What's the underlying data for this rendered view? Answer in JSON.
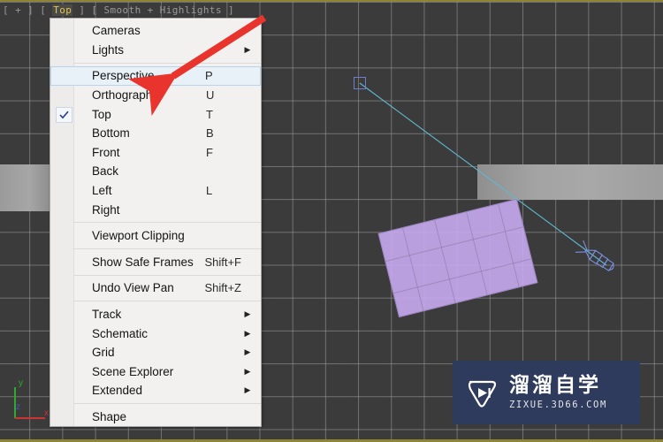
{
  "viewport": {
    "label_parts": {
      "open": "[",
      "plus": "+",
      "b1": "]",
      "b2": "[",
      "view": "Top",
      "b3": "]",
      "b4": "[",
      "shading": "Smooth + Highlights",
      "close": "]"
    },
    "label_full": "[ + ] [ Top ] [ Smooth + Highlights ]",
    "active_border_color": "#8d8437",
    "background_color": "#3b3b3b",
    "grid_line_color": "#a0a0a0",
    "objects": {
      "camera_target": "camera-target-square",
      "camera_gizmo": "camera-wireframe",
      "camera_line": "camera-target-line",
      "box_color": "#c6a8ee",
      "wall_color": "#a3a3a3"
    },
    "axis_tripod": {
      "x_label": "x",
      "y_label": "y",
      "z_label": "z",
      "x_color": "#cc3333",
      "y_color": "#33aa33",
      "z_color": "#4455cc"
    }
  },
  "context_menu": {
    "items": [
      {
        "label": "Cameras",
        "shortcut": "",
        "arrow": true,
        "checked": false,
        "selected": false,
        "separator_after": false
      },
      {
        "label": "Lights",
        "shortcut": "",
        "arrow": true,
        "checked": false,
        "selected": false,
        "separator_after": true
      },
      {
        "label": "Perspective",
        "shortcut": "P",
        "arrow": false,
        "checked": false,
        "selected": true,
        "separator_after": false
      },
      {
        "label": "Orthographic",
        "shortcut": "U",
        "arrow": false,
        "checked": false,
        "selected": false,
        "separator_after": false
      },
      {
        "label": "Top",
        "shortcut": "T",
        "arrow": false,
        "checked": true,
        "selected": false,
        "separator_after": false
      },
      {
        "label": "Bottom",
        "shortcut": "B",
        "arrow": false,
        "checked": false,
        "selected": false,
        "separator_after": false
      },
      {
        "label": "Front",
        "shortcut": "F",
        "arrow": false,
        "checked": false,
        "selected": false,
        "separator_after": false
      },
      {
        "label": "Back",
        "shortcut": "",
        "arrow": false,
        "checked": false,
        "selected": false,
        "separator_after": false
      },
      {
        "label": "Left",
        "shortcut": "L",
        "arrow": false,
        "checked": false,
        "selected": false,
        "separator_after": false
      },
      {
        "label": "Right",
        "shortcut": "",
        "arrow": false,
        "checked": false,
        "selected": false,
        "separator_after": true
      },
      {
        "label": "Viewport Clipping",
        "shortcut": "",
        "arrow": false,
        "checked": false,
        "selected": false,
        "separator_after": true
      },
      {
        "label": "Show Safe Frames",
        "shortcut": "Shift+F",
        "arrow": false,
        "checked": false,
        "selected": false,
        "separator_after": true
      },
      {
        "label": "Undo View Pan",
        "shortcut": "Shift+Z",
        "arrow": false,
        "checked": false,
        "selected": false,
        "separator_after": true
      },
      {
        "label": "Track",
        "shortcut": "",
        "arrow": true,
        "checked": false,
        "selected": false,
        "separator_after": false
      },
      {
        "label": "Schematic",
        "shortcut": "",
        "arrow": true,
        "checked": false,
        "selected": false,
        "separator_after": false
      },
      {
        "label": "Grid",
        "shortcut": "",
        "arrow": true,
        "checked": false,
        "selected": false,
        "separator_after": false
      },
      {
        "label": "Scene Explorer",
        "shortcut": "",
        "arrow": true,
        "checked": false,
        "selected": false,
        "separator_after": false
      },
      {
        "label": "Extended",
        "shortcut": "",
        "arrow": true,
        "checked": false,
        "selected": false,
        "separator_after": true
      },
      {
        "label": "Shape",
        "shortcut": "",
        "arrow": false,
        "checked": false,
        "selected": false,
        "separator_after": false
      }
    ]
  },
  "annotation": {
    "arrow_color": "#e8342c",
    "points_at": "Perspective"
  },
  "watermark": {
    "brand_cn": "溜溜自学",
    "url": "ZIXUE.3D66.COM",
    "background_color": "#2e3b5c",
    "icon": "play-button-icon"
  }
}
